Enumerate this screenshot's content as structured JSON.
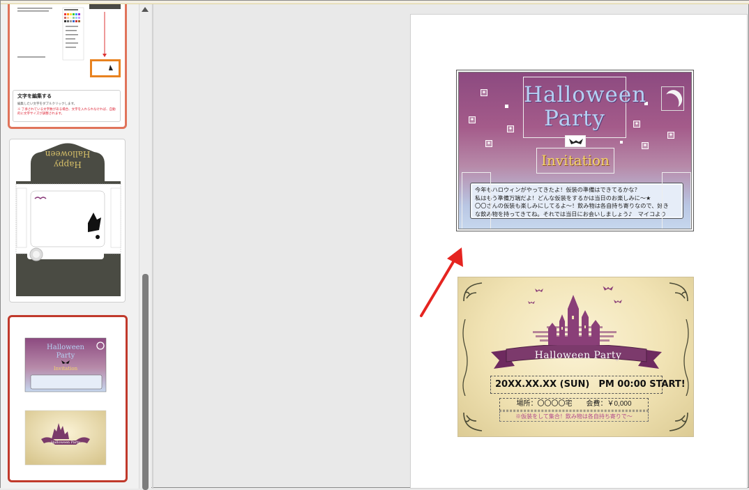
{
  "thumbnails": {
    "step": {
      "heading": "文字を編集する",
      "line1": "編集したい文字をダブルクリックします。",
      "note": "※ 了承されている文字数がある場合、文字を入れられなければ、自動的に文字サイズが調整されます。"
    },
    "envelope": {
      "title": "Happy Halloween"
    },
    "slide": {
      "title": "Halloween Party",
      "invitation": "Invitation",
      "flyer_title": "Halloween Party"
    }
  },
  "card1": {
    "title_line1": "Halloween",
    "title_line2": "Party",
    "invitation": "Invitation",
    "message": [
      "今年もハロウィンがやってきたよ！仮装の準備はできてるかな？",
      "私はもう準備万端だよ！どんな仮装をするかは当日のお楽しみに～★",
      "〇〇さんの仮装も楽しみにしてるよ～！飲み物は各自持ち寄りなので、好き",
      "な飲み物を持ってきてね。それでは当日にお会いしましょう♪　マイコより"
    ]
  },
  "card2": {
    "banner": "Halloween Party",
    "date": "20XX.XX.XX (SUN)　PM 00:00 START!",
    "place": "場所：〇〇〇〇宅　　会費：￥0,000",
    "note": "※仮装をして集合！飲み物は各自持ち寄りで～"
  },
  "colors": {
    "card1_top": "#8c4a80",
    "card1_bottom": "#c6d7ee",
    "title_text": "#b5d0f3",
    "invitation_text": "#f4d46a",
    "annotation_arrow": "#e52420",
    "selected_thumb_border": "#c0392b"
  }
}
